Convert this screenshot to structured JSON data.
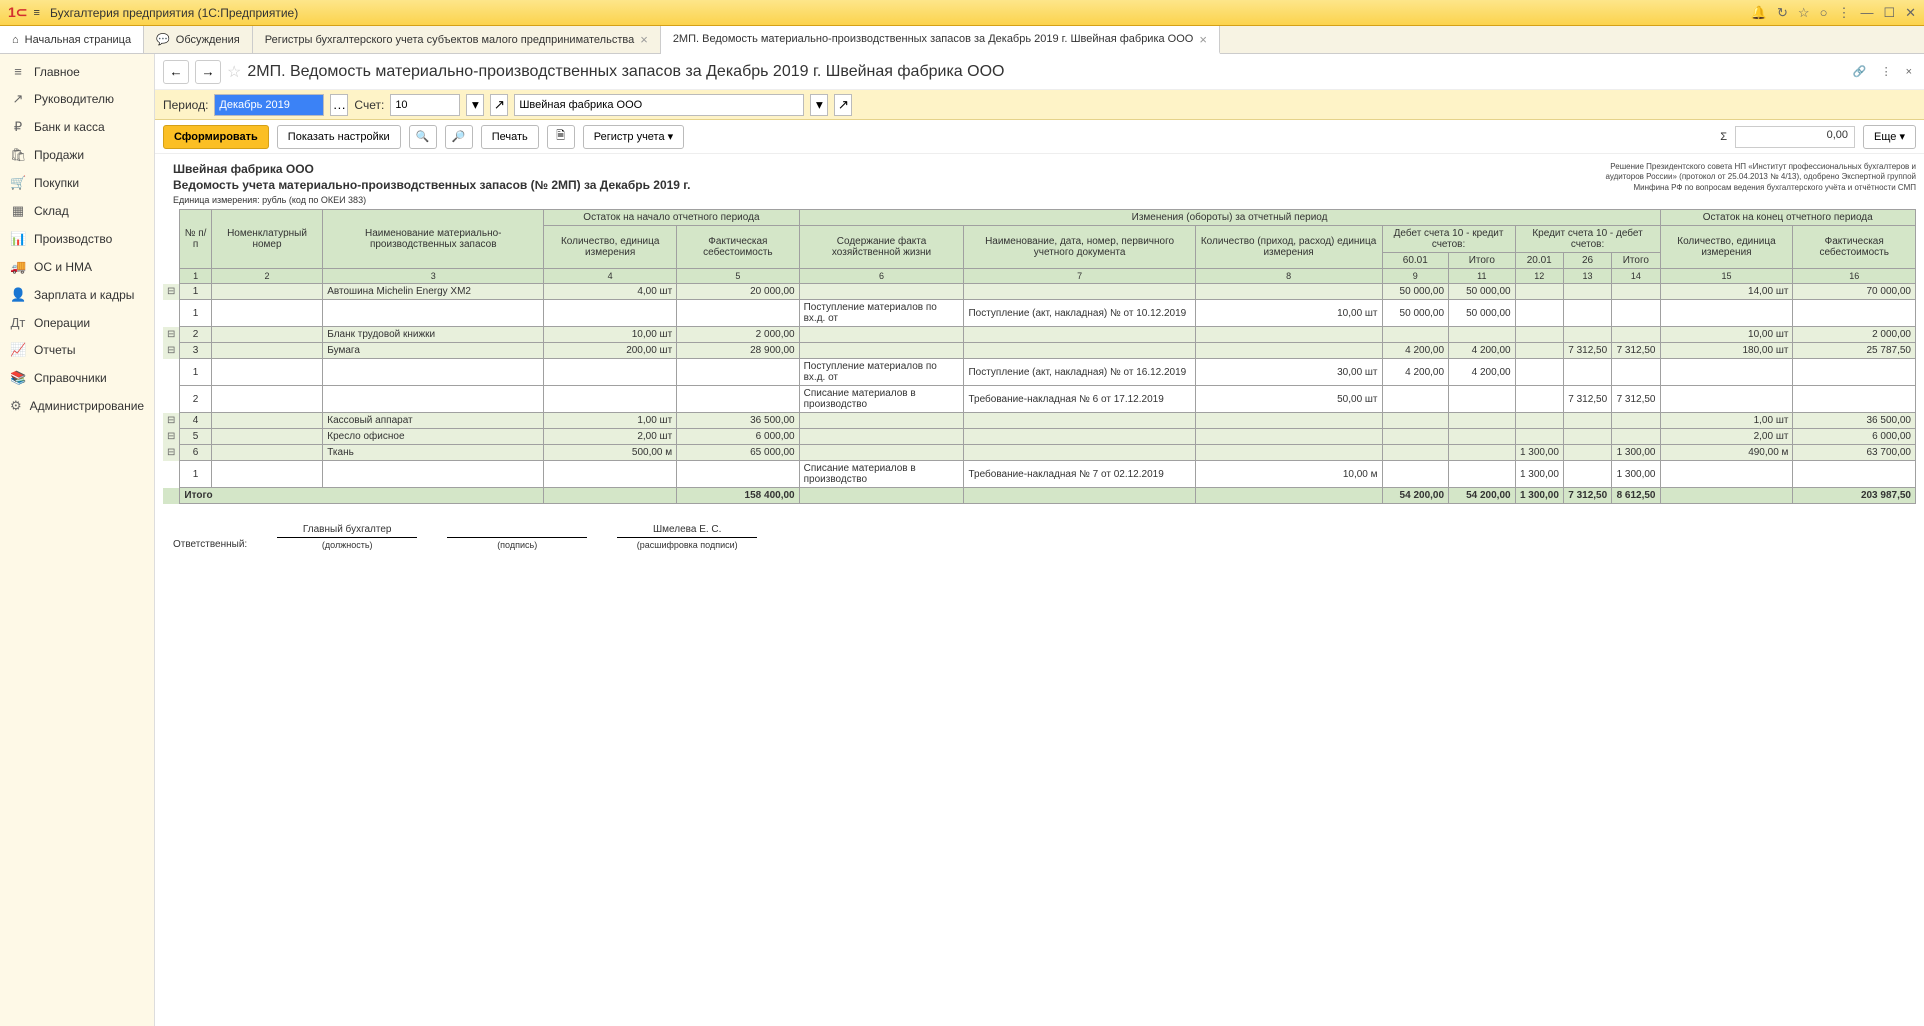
{
  "app": {
    "title": "Бухгалтерия предприятия  (1С:Предприятие)"
  },
  "tabs": {
    "home": "Начальная страница",
    "discuss": "Обсуждения",
    "t1": "Регистры бухгалтерского учета субъектов малого предпринимательства",
    "t2": "2МП. Ведомость материально-производственных запасов за Декабрь 2019 г. Швейная фабрика ООО"
  },
  "sidebar": [
    {
      "icon": "≡",
      "label": "Главное"
    },
    {
      "icon": "↗",
      "label": "Руководителю"
    },
    {
      "icon": "₽",
      "label": "Банк и касса"
    },
    {
      "icon": "🛍",
      "label": "Продажи"
    },
    {
      "icon": "🛒",
      "label": "Покупки"
    },
    {
      "icon": "▦",
      "label": "Склад"
    },
    {
      "icon": "📊",
      "label": "Производство"
    },
    {
      "icon": "🚚",
      "label": "ОС и НМА"
    },
    {
      "icon": "👤",
      "label": "Зарплата и кадры"
    },
    {
      "icon": "Дт",
      "label": "Операции"
    },
    {
      "icon": "📈",
      "label": "Отчеты"
    },
    {
      "icon": "📚",
      "label": "Справочники"
    },
    {
      "icon": "⚙",
      "label": "Администрирование"
    }
  ],
  "doc": {
    "title": "2МП. Ведомость материально-производственных запасов за Декабрь 2019 г. Швейная фабрика ООО",
    "period_lbl": "Период:",
    "period_val": "Декабрь 2019",
    "account_lbl": "Счет:",
    "account_val": "10",
    "org_val": "Швейная фабрика ООО"
  },
  "toolbar": {
    "form": "Сформировать",
    "settings": "Показать настройки",
    "print": "Печать",
    "reg": "Регистр учета",
    "more": "Еще",
    "sum": "0,00"
  },
  "report": {
    "org": "Швейная фабрика ООО",
    "title": "Ведомость учета материально-производственных запасов (№ 2МП) за Декабрь 2019 г.",
    "unit": "Единица измерения:  рубль (код по ОКЕИ 383)",
    "notice1": "Решение Президентского совета НП «Институт профессиональных бухгалтеров и",
    "notice2": "аудиторов России» (протокол от 25.04.2013 № 4/13), одобрено Экспертной группой",
    "notice3": "Минфина РФ по вопросам ведения бухгалтерского учёта и отчётности СМП"
  },
  "headers": {
    "npp": "№ п/п",
    "nomnum": "Номенклатурный номер",
    "name": "Наименование материально-производственных запасов",
    "ost_begin": "Остаток\nна начало отчетного периода",
    "qty_unit": "Количество, единица измерения",
    "cost": "Фактическая себестоимость",
    "changes": "Изменения (обороты) за отчетный период",
    "life": "Содержание факта хозяйственной жизни",
    "docname": "Наименование, дата, номер, первичного учетного документа",
    "qty_io": "Количество (приход, расход) единица измерения",
    "debit": "Дебет счета 10 - кредит счетов:",
    "credit": "Кредит счета 10 - дебет счетов:",
    "c6001": "60.01",
    "ctot1": "Итого",
    "c2001": "20.01",
    "c26": "26",
    "ctot2": "Итого",
    "ost_end": "Остаток\nна конец отчетного периода",
    "total": "Итого"
  },
  "sign": {
    "resp": "Ответственный:",
    "pos": "Главный бухгалтер",
    "pos_cap": "(должность)",
    "sig_cap": "(подпись)",
    "name": "Шмелева Е. С.",
    "name_cap": "(расшифровка подписи)"
  },
  "rows": [
    {
      "t": "g",
      "n": "1",
      "name": "Автошина Michelin Energy XM2",
      "q0": "4,00 шт",
      "c0": "20 000,00",
      "d6001": "50 000,00",
      "dtot": "50 000,00",
      "q1": "14,00 шт",
      "c1": "70 000,00"
    },
    {
      "t": "d",
      "n": "1",
      "life": "Поступление материалов по вх.д.  от",
      "doc": "Поступление (акт, накладная) №  от 10.12.2019",
      "qio": "10,00 шт",
      "d6001": "50 000,00",
      "dtot": "50 000,00"
    },
    {
      "t": "g",
      "n": "2",
      "name": "Бланк трудовой книжки",
      "q0": "10,00 шт",
      "c0": "2 000,00",
      "q1": "10,00 шт",
      "c1": "2 000,00"
    },
    {
      "t": "g",
      "n": "3",
      "name": "Бумага",
      "q0": "200,00 шт",
      "c0": "28 900,00",
      "d6001": "4 200,00",
      "dtot": "4 200,00",
      "k26": "7 312,50",
      "ktot": "7 312,50",
      "q1": "180,00 шт",
      "c1": "25 787,50"
    },
    {
      "t": "d",
      "n": "1",
      "life": "Поступление материалов по вх.д.  от",
      "doc": "Поступление (акт, накладная) №  от 16.12.2019",
      "qio": "30,00 шт",
      "d6001": "4 200,00",
      "dtot": "4 200,00"
    },
    {
      "t": "d",
      "n": "2",
      "life": "Списание материалов в производство",
      "doc": "Требование-накладная № 6 от 17.12.2019",
      "qio": "50,00 шт",
      "k26": "7 312,50",
      "ktot": "7 312,50"
    },
    {
      "t": "g",
      "n": "4",
      "name": "Кассовый аппарат",
      "q0": "1,00 шт",
      "c0": "36 500,00",
      "q1": "1,00 шт",
      "c1": "36 500,00"
    },
    {
      "t": "g",
      "n": "5",
      "name": "Кресло офисное",
      "q0": "2,00 шт",
      "c0": "6 000,00",
      "q1": "2,00 шт",
      "c1": "6 000,00"
    },
    {
      "t": "g",
      "n": "6",
      "name": "Ткань",
      "q0": "500,00 м",
      "c0": "65 000,00",
      "k2001": "1 300,00",
      "ktot": "1 300,00",
      "q1": "490,00 м",
      "c1": "63 700,00"
    },
    {
      "t": "d",
      "n": "1",
      "life": "Списание материалов в производство",
      "doc": "Требование-накладная № 7 от 02.12.2019",
      "qio": "10,00 м",
      "k2001": "1 300,00",
      "ktot": "1 300,00"
    }
  ],
  "totals": {
    "c0": "158 400,00",
    "d6001": "54 200,00",
    "dtot": "54 200,00",
    "k2001": "1 300,00",
    "k26": "7 312,50",
    "ktot": "8 612,50",
    "c1": "203 987,50"
  }
}
